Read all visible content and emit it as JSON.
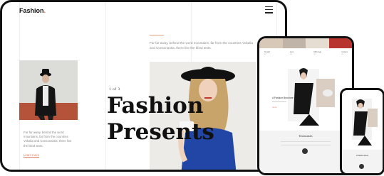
{
  "desktop": {
    "brand": "Fashion",
    "brand_dot": ".",
    "top_paragraph": "Far far away, behind the word mountains, far from the countries Vokalia and Consonantia, there live the blind texts.",
    "left_paragraph": "Far far away, behind the word mountains, far from the countries Vokalia and Consonantia, there live the blind texts.",
    "learn_more": "Learn more",
    "slide_counter": "1 of 3",
    "hero_line1": "Fashion",
    "hero_line2": "Presents"
  },
  "tablet": {
    "categories": [
      {
        "name": "Small",
        "sub": "xx"
      },
      {
        "name": "Hot",
        "sub": "xx"
      },
      {
        "name": "Minimal",
        "sub": "xx"
      },
      {
        "name": "Colors",
        "sub": "xx"
      }
    ],
    "feature_title": "A Fashion Brochure",
    "feature_link": "more",
    "testimonials_label": "Testimonials"
  },
  "phone": {
    "testimonials_label": "Testimonials"
  },
  "colors": {
    "accent": "#e07a5f",
    "frame": "#111111"
  }
}
